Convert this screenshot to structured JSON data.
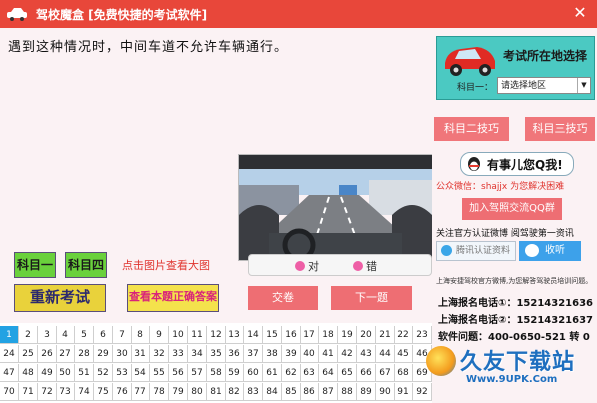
{
  "window": {
    "title": "驾校魔盒 [免费快捷的考试软件]",
    "close": "✕"
  },
  "question": {
    "text": "遇到这种情况时，中间车道不允许车辆通行。"
  },
  "buttons": {
    "subject1": "科目一",
    "subject4": "科目四",
    "reexam": "重新考试",
    "show_answer": "查看本题正确答案",
    "submit": "交卷",
    "next": "下一题"
  },
  "hint": "点击图片查看大图",
  "options": {
    "correct": "对",
    "wrong": "错"
  },
  "grid": {
    "numbers": [
      1,
      2,
      3,
      4,
      5,
      6,
      7,
      8,
      9,
      10,
      11,
      12,
      13,
      14,
      15,
      16,
      17,
      18,
      19,
      20,
      21,
      22,
      23,
      24,
      25,
      26,
      27,
      28,
      29,
      30,
      31,
      32,
      33,
      34,
      35,
      36,
      37,
      38,
      39,
      40,
      41,
      42,
      43,
      44,
      45,
      46,
      47,
      48,
      49,
      50,
      51,
      52,
      53,
      54,
      55,
      56,
      57,
      58,
      59,
      60,
      61,
      62,
      63,
      64,
      65,
      66,
      67,
      68,
      69,
      70,
      71,
      72,
      73,
      74,
      75,
      76,
      77,
      78,
      79,
      80,
      81,
      82,
      83,
      84,
      85,
      86,
      87,
      88,
      89,
      90,
      91,
      92
    ],
    "active": 1
  },
  "sidebar": {
    "banner_title": "考试所在地选择",
    "subject_label": "科目一：",
    "region_value": "请选择地区",
    "tips2": "科目二技巧",
    "tips3": "科目三技巧",
    "qq_text": "有事儿您Q我!",
    "wechat": "公众微信：shajjx  为您解决困难",
    "join_qq": "加入驾照交流QQ群",
    "follow": "关注官方认证微博  阅驾驶第一资讯",
    "weibo_btn": "腾讯认证资料",
    "listen_btn": "收听",
    "description": "上海安捷驾校官方微博,为您解答驾驶员培训问题。",
    "phone1": "上海报名电话①：15214321636",
    "phone2": "上海报名电话②：15214321637",
    "software": "软件问题：400-0650-521  转 0"
  },
  "watermark": {
    "text": "久友下载站",
    "url": "Www.9UPK.Com"
  },
  "colors": {
    "title_bar": "#e8473a",
    "accent_pink": "#ee6e73",
    "grid_active": "#22a2e3",
    "banner": "#4bc9c2"
  }
}
